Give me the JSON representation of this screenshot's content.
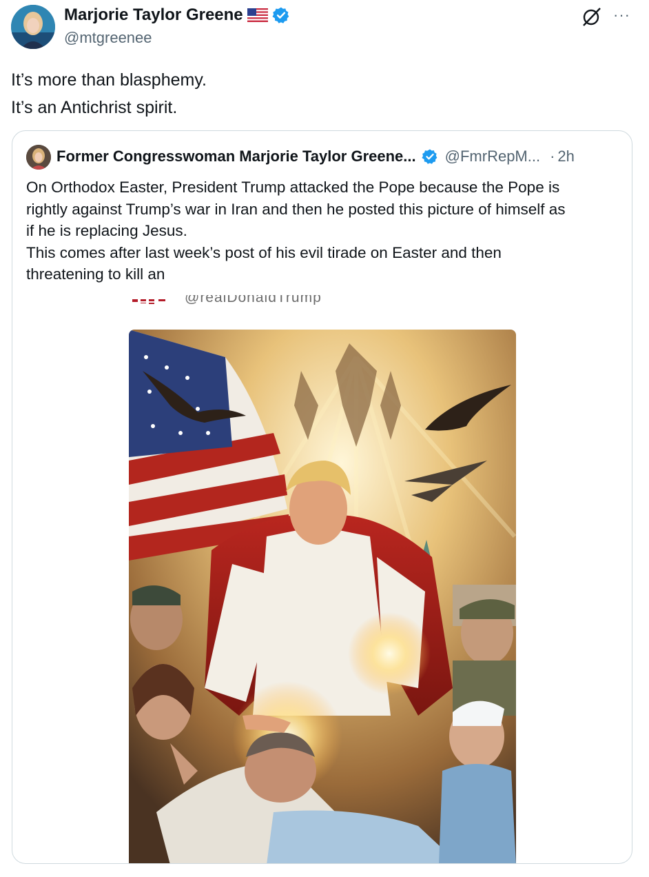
{
  "author": {
    "name": "Marjorie Taylor Greene",
    "handle": "@mtgreenee",
    "flag_icon": "us-flag-icon",
    "verified_icon": "verified-badge-icon"
  },
  "toolbar": {
    "grok_icon": "grok-icon",
    "more_icon": "more-options-icon",
    "more_glyph": "···"
  },
  "tweet": {
    "lines": [
      "It’s more than blasphemy.",
      "It’s an Antichrist spirit."
    ]
  },
  "quote": {
    "name": "Former Congresswoman Marjorie Taylor Greene...",
    "handle": "@FmrRepM...",
    "dot": "·",
    "time": "2h",
    "lines": [
      "On Orthodox Easter, President Trump attacked the Pope because the Pope is",
      "rightly against Trump’s war in Iran and then he posted this picture of himself as",
      "if he is replacing Jesus.",
      "This comes after last week’s post of his evil tirade on Easter and then",
      "threatening to kill an"
    ],
    "media_caption": "@realDonaldTrump"
  },
  "colors": {
    "verified": "#1d9bf0",
    "secondary_text": "#536471",
    "border": "#cfd9de"
  }
}
